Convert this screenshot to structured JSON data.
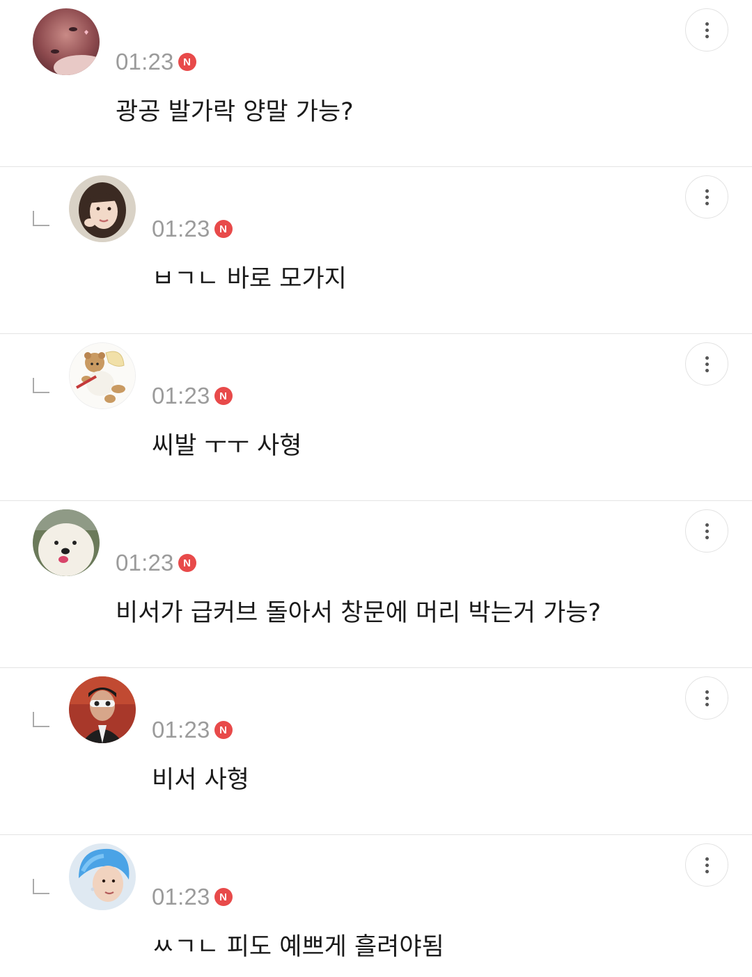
{
  "comments": [
    {
      "time": "01:23",
      "badge": "N",
      "text": "광공 발가락 양말 가능?",
      "reply": false,
      "avatar": "avatar-photo-dark"
    },
    {
      "time": "01:23",
      "badge": "N",
      "text": "ㅂㄱㄴ 바로 모가지",
      "reply": true,
      "avatar": "avatar-girl-photo"
    },
    {
      "time": "01:23",
      "badge": "N",
      "text": "씨발 ㅜㅜ 사형",
      "reply": true,
      "avatar": "avatar-teddy-bear"
    },
    {
      "time": "01:23",
      "badge": "N",
      "text": "비서가 급커브 돌아서 창문에 머리 박는거 가능?",
      "reply": false,
      "avatar": "avatar-white-dog"
    },
    {
      "time": "01:23",
      "badge": "N",
      "text": "비서 사형",
      "reply": true,
      "avatar": "avatar-man-sunglasses"
    },
    {
      "time": "01:23",
      "badge": "N",
      "text": "ㅆㄱㄴ 피도 예쁘게 흘려야됨",
      "reply": true,
      "avatar": "avatar-blue-hair"
    }
  ],
  "icons": {
    "more": "more-vertical-icon",
    "reply": "reply-arrow-icon",
    "new": "new-badge-icon"
  },
  "colors": {
    "badge": "#e84a4a",
    "time": "#9b9b9b",
    "divider": "#e4e4e4"
  }
}
